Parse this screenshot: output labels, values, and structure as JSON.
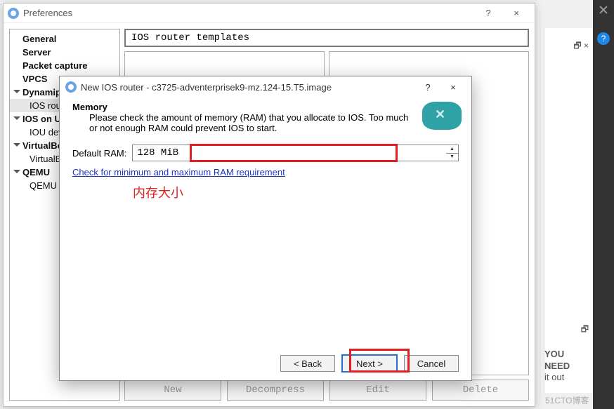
{
  "background": {
    "you_need_title": "YOU NEED",
    "you_need_line": "it out"
  },
  "prefs": {
    "title": "Preferences",
    "help_glyph": "?",
    "close_glyph": "×",
    "tree": {
      "general": "General",
      "server": "Server",
      "packet_capture": "Packet capture",
      "vpcs": "VPCS",
      "dynamips": "Dynamips",
      "ios_routers": "IOS routers",
      "ios_on_unix": "IOS on UNIX",
      "iou_devices": "IOU devices",
      "virtualbox": "VirtualBox",
      "virtualbox_vms": "VirtualBox VMs",
      "qemu": "QEMU",
      "qemu_vms": "QEMU VMs"
    },
    "content": {
      "heading": "IOS router templates",
      "buttons": {
        "new": "New",
        "decompress": "Decompress",
        "edit": "Edit",
        "delete": "Delete"
      }
    }
  },
  "wizard": {
    "title": "New IOS router - c3725-adventerprisek9-mz.124-15.T5.image",
    "help_glyph": "?",
    "close_glyph": "×",
    "section_title": "Memory",
    "section_desc": "Please check the amount of memory (RAM) that you allocate to IOS. Too much or not enough RAM could prevent IOS to start.",
    "default_ram_label": "Default RAM:",
    "default_ram_value": "128 MiB",
    "ram_link_text": "Check for minimum and maximum RAM requirement",
    "annotation": "内存大小",
    "buttons": {
      "back": "< Back",
      "next": "Next >",
      "cancel": "Cancel"
    }
  },
  "watermark": "51CTO博客"
}
